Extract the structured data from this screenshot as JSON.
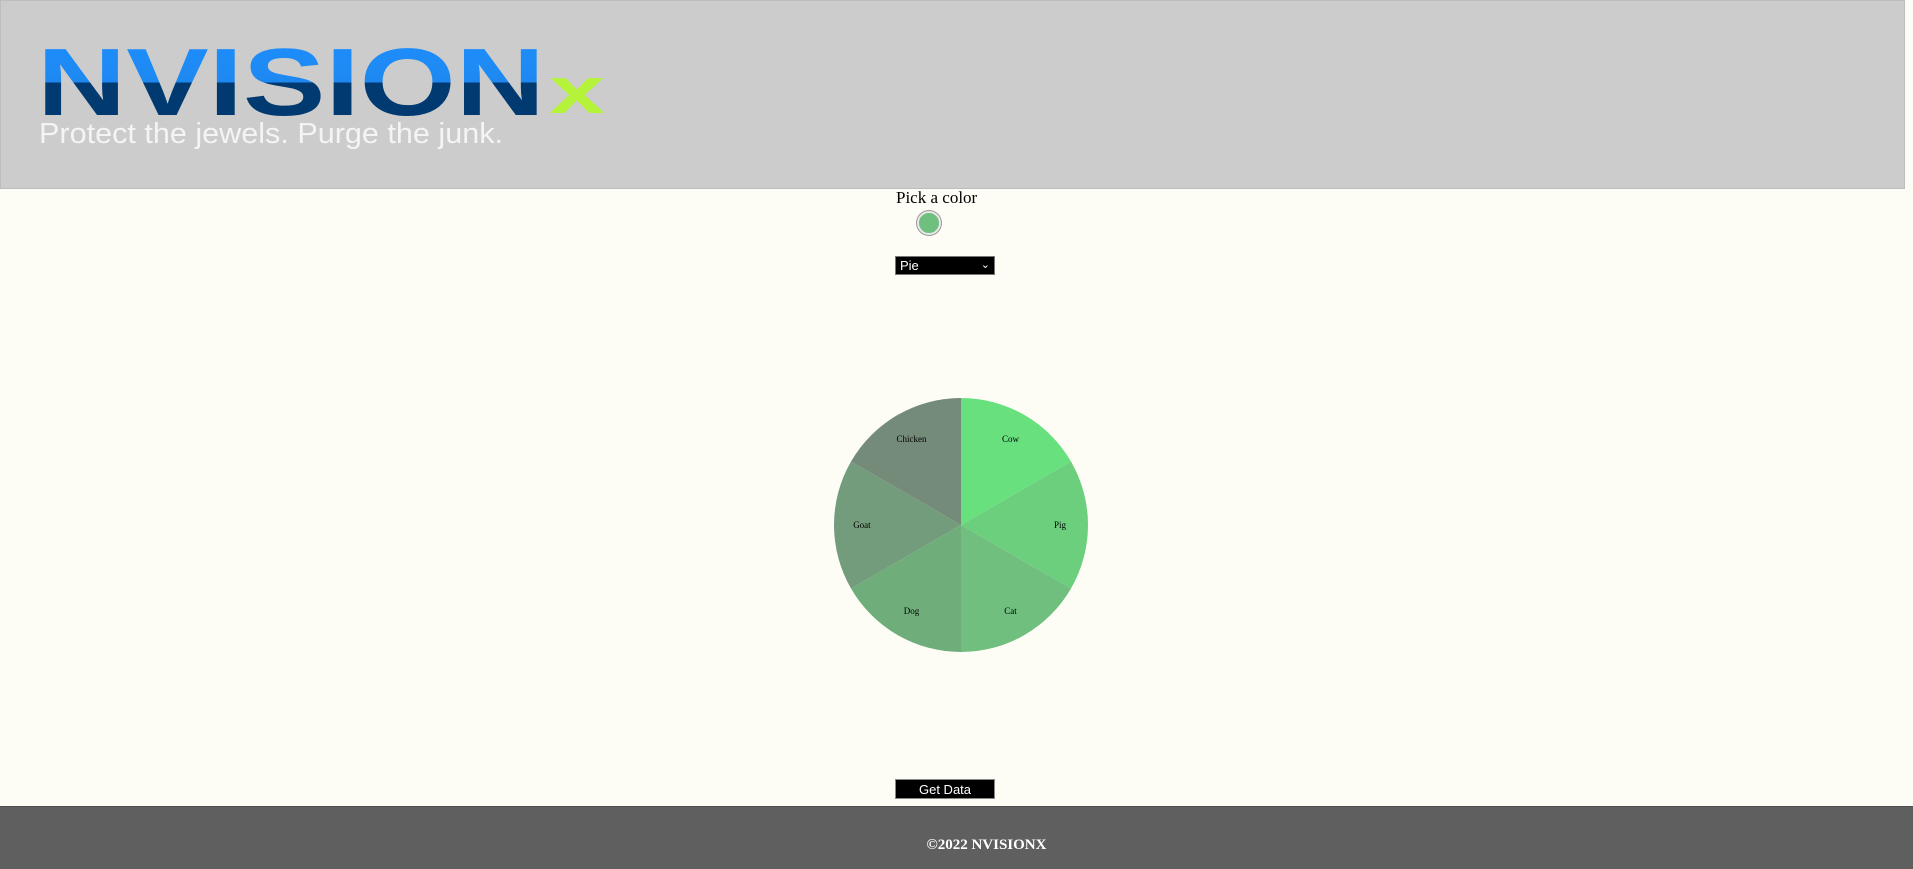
{
  "header": {
    "logo_wordmark": "NVISION",
    "logo_x": "x",
    "tagline": "Protect the jewels. Purge the junk.",
    "brand_blue": "#1e90ff",
    "brand_navy": "#003a70",
    "brand_green": "#b5f23a",
    "logo_icon": "nvisionx-logo"
  },
  "picker": {
    "label": "Pick a color",
    "selected_color": "#6fbf7f"
  },
  "chart_select": {
    "selected": "Pie",
    "icon": "chevron-down-icon"
  },
  "chart_data": {
    "type": "pie",
    "categories": [
      "Cow",
      "Pig",
      "Cat",
      "Dog",
      "Goat",
      "Chicken"
    ],
    "values": [
      1,
      1,
      1,
      1,
      1,
      1
    ],
    "colors": [
      "#69e07e",
      "#6ccf7e",
      "#70bf7f",
      "#6fad7b",
      "#729c7b",
      "#758b79"
    ]
  },
  "actions": {
    "get_data_label": "Get Data"
  },
  "footer": {
    "copyright": "©2022 NVISIONX"
  }
}
